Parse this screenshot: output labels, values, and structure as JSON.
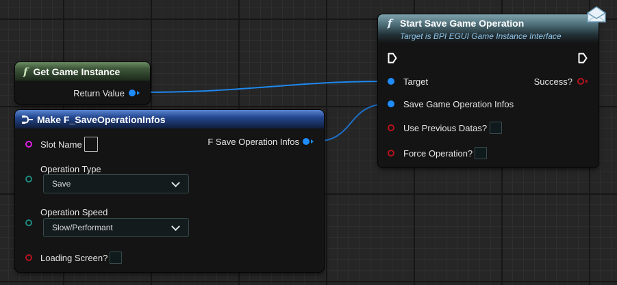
{
  "nodes": {
    "get_game_instance": {
      "title": "Get Game Instance",
      "return_value_label": "Return Value"
    },
    "make_save_operation_infos": {
      "title": "Make F_SaveOperationInfos",
      "slot_name_label": "Slot Name",
      "operation_type_label": "Operation Type",
      "operation_type_value": "Save",
      "operation_speed_label": "Operation Speed",
      "operation_speed_value": "Slow/Performant",
      "loading_screen_label": "Loading Screen?",
      "output_label": "F Save Operation Infos"
    },
    "start_save_game_operation": {
      "title": "Start Save Game Operation",
      "subtitle": "Target is BPI EGUI Game Instance Interface",
      "target_label": "Target",
      "success_label": "Success?",
      "save_infos_label": "Save Game Operation Infos",
      "use_previous_datas_label": "Use Previous Datas?",
      "force_operation_label": "Force Operation?"
    }
  },
  "icons": {
    "function": "f-icon",
    "make_struct": "make-struct-icon",
    "message": "envelope-icon",
    "exec": "exec-triangle-icon"
  },
  "colors": {
    "function_header": "#3f5a3f",
    "struct_header": "#1f3a78",
    "interface_header": "#4a6570",
    "object_pin": "#1f8cff",
    "bool_pin": "#b5131e",
    "byte_pin": "#1d8a7e",
    "string_pin": "#e11ee6"
  }
}
